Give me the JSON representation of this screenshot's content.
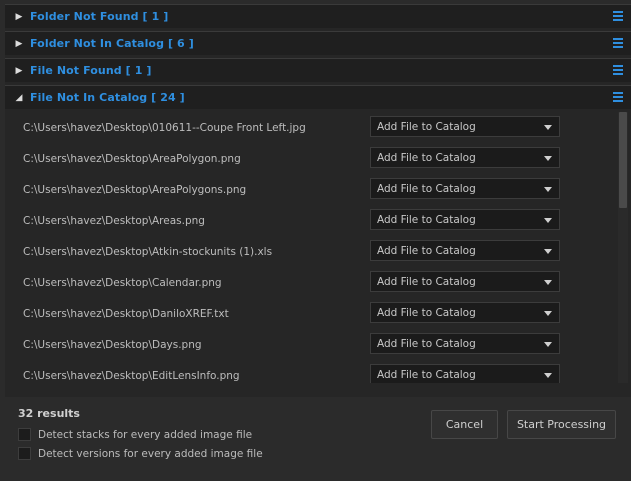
{
  "sections": [
    {
      "title": "Folder Not Found  [ 1 ]",
      "expanded": false
    },
    {
      "title": "Folder Not In Catalog  [ 6 ]",
      "expanded": false
    },
    {
      "title": "File Not Found  [ 1 ]",
      "expanded": false
    },
    {
      "title": "File Not In Catalog  [ 24 ]",
      "expanded": true
    }
  ],
  "files": [
    {
      "path": "C:\\Users\\havez\\Desktop\\010611--Coupe Front Left.jpg",
      "action": "Add File to Catalog"
    },
    {
      "path": "C:\\Users\\havez\\Desktop\\AreaPolygon.png",
      "action": "Add File to Catalog"
    },
    {
      "path": "C:\\Users\\havez\\Desktop\\AreaPolygons.png",
      "action": "Add File to Catalog"
    },
    {
      "path": "C:\\Users\\havez\\Desktop\\Areas.png",
      "action": "Add File to Catalog"
    },
    {
      "path": "C:\\Users\\havez\\Desktop\\Atkin-stockunits (1).xls",
      "action": "Add File to Catalog"
    },
    {
      "path": "C:\\Users\\havez\\Desktop\\Calendar.png",
      "action": "Add File to Catalog"
    },
    {
      "path": "C:\\Users\\havez\\Desktop\\DaniloXREF.txt",
      "action": "Add File to Catalog"
    },
    {
      "path": "C:\\Users\\havez\\Desktop\\Days.png",
      "action": "Add File to Catalog"
    },
    {
      "path": "C:\\Users\\havez\\Desktop\\EditLensInfo.png",
      "action": "Add File to Catalog"
    }
  ],
  "footer": {
    "results": "32 results",
    "detect_stacks": "Detect stacks for every added image file",
    "detect_versions": "Detect versions for every added image file",
    "cancel": "Cancel",
    "start": "Start Processing"
  },
  "colors": {
    "accent": "#2f8fe0"
  }
}
